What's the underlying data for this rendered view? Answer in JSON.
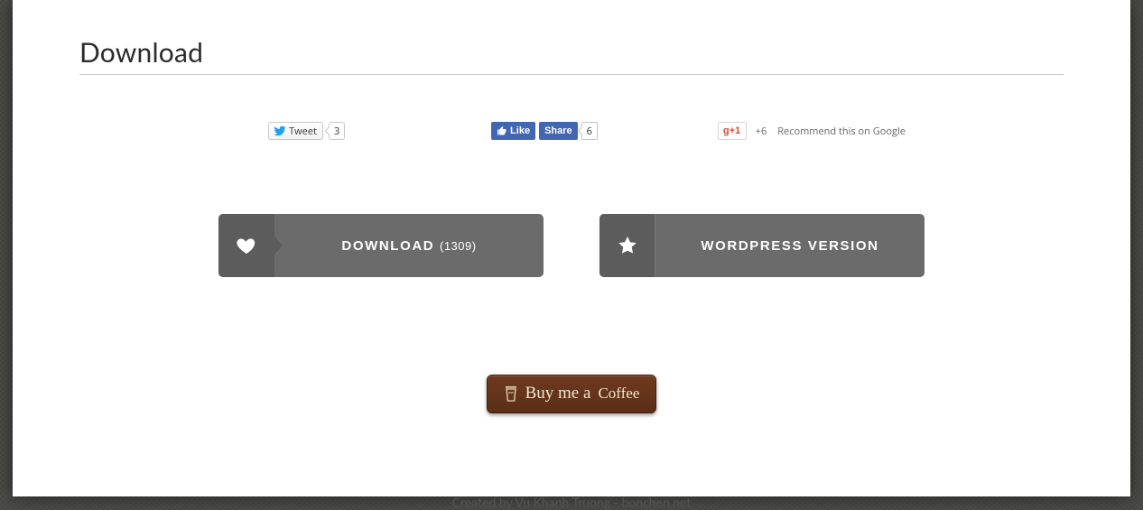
{
  "title": "Download",
  "social": {
    "twitter": {
      "label": "Tweet",
      "count": "3"
    },
    "facebook": {
      "like_label": "Like",
      "share_label": "Share",
      "count": "6"
    },
    "google": {
      "btn_g": "g",
      "btn_plus": "+1",
      "count": "+6",
      "recommend": "Recommend this on Google"
    }
  },
  "buttons": {
    "download": {
      "label": "DOWNLOAD",
      "count": "(1309)"
    },
    "wordpress": {
      "label": "WORDPRESS VERSION"
    }
  },
  "coffee": {
    "prefix": "Buy me a",
    "suffix": "Coffee"
  },
  "footer": {
    "created_by": "Created by Vu Khanh Truong - ",
    "site": "bonchen.net"
  }
}
